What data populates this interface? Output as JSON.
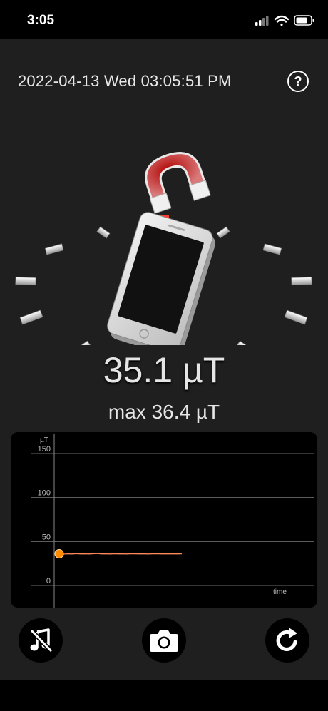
{
  "status": {
    "time": "3:05"
  },
  "header": {
    "datetime": "2022-04-13 Wed 03:05:51 PM",
    "help_label": "?"
  },
  "reading": {
    "value": "35.1 µT",
    "max": "max 36.4 µT"
  },
  "chart_data": {
    "type": "line",
    "ylabel": "µT",
    "xlabel": "time",
    "ylim": [
      0,
      150
    ],
    "yticks": [
      0,
      50,
      100,
      150
    ],
    "series": [
      {
        "values": [
          36.1,
          35.7,
          36.0,
          35.8,
          36.2,
          35.9,
          36.0,
          35.8,
          36.1,
          36.4,
          35.9,
          36.0,
          35.8,
          36.1,
          35.9,
          36.0,
          35.8,
          36.1,
          36.0,
          35.9,
          36.0,
          35.8,
          36.0,
          36.1,
          35.9,
          36.0,
          35.9,
          36.0,
          35.9,
          36.0
        ]
      }
    ],
    "color": "#ff8c00"
  },
  "controls": {
    "mute_icon": "music-note-muted-icon",
    "camera_icon": "camera-icon",
    "reset_icon": "refresh-icon"
  }
}
